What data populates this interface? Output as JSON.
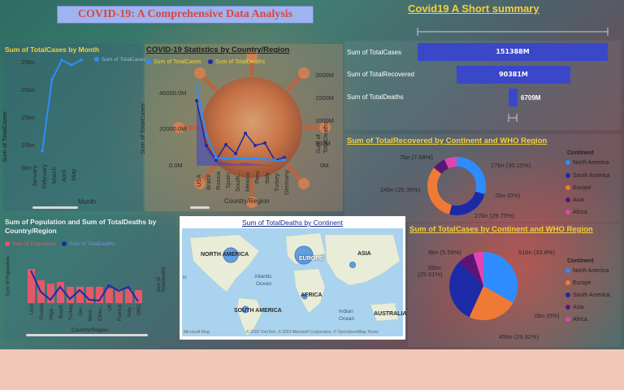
{
  "header": {
    "title": "COVID-19: A Comprehensive Data Analysis",
    "summary_title": "Covid19 A Short summary"
  },
  "colors": {
    "blue": "#2f8cff",
    "navy": "#1c2aa8",
    "orange": "#ef7a36",
    "purple": "#5b1577",
    "pink": "#e045b3",
    "bar": "#3b47c9",
    "population_bar": "#e4596a"
  },
  "summary": {
    "rows": [
      {
        "label": "Sum of TotalCases",
        "value_text": "151388M",
        "value": 151388
      },
      {
        "label": "Sum of TotalRecovered",
        "value_text": "90381M",
        "value": 90381
      },
      {
        "label": "Sum of TotalDeaths",
        "value_text": "6709M",
        "value": 6709
      }
    ]
  },
  "month_chart": {
    "title": "Sum of TotalCases by Month",
    "legend": "Sum of TotalCases",
    "ylabel": "Sum of TotalCases",
    "xlabel": "Month",
    "yticks": [
      "25bn",
      "20bn",
      "15bn",
      "10bn",
      "5bn"
    ],
    "categories": [
      "January",
      "February",
      "March",
      "April",
      "May"
    ]
  },
  "country_chart": {
    "title": "COVID-19 Statistics by Country/Region",
    "legend_cases": "Sum of TotalCases",
    "legend_deaths": "Sum of TotalDeaths",
    "ylabel_left": "Sum of TotalCases",
    "ylabel_right": "Sum of TotalDeaths",
    "xlabel": "Country/Region",
    "yticks_left": [
      "40000.0M",
      "20000.0M",
      "0.0M"
    ],
    "yticks_right": [
      "2000M",
      "1500M",
      "1000M",
      "500M",
      "0M"
    ],
    "categories": [
      "USA",
      "Brazil",
      "Russia",
      "Spain",
      "South...",
      "Mexico",
      "Peru",
      "Italy",
      "Turkey",
      "Germany"
    ]
  },
  "population_chart": {
    "title": "Sum of Population and Sum of TotalDeaths by Country/Region",
    "legend_pop": "Sum of Population",
    "legend_deaths": "Sum of TotalDeaths",
    "ylabel_left": "Sum of Population",
    "ylabel_right": "Sum of TotalDeaths",
    "xlabel": "Country/Region",
    "categories": [
      "USA",
      "Russia",
      "Nige...",
      "Brazil",
      "Turkey",
      "Ger...",
      "Mexi...",
      "Ethio...",
      "UK",
      "France",
      "Italy",
      "DRC"
    ]
  },
  "map": {
    "title": "Sum of TotalDeaths by Continent",
    "labels": {
      "north_america": "NORTH AMERICA",
      "europe": "EUROPE",
      "asia": "ASIA",
      "africa": "AFRICA",
      "south_america": "SOUTH AMERICA",
      "australia": "AUSTRALIA",
      "atlantic": "Atlantic\nOcean",
      "atlantic_1": "Atlantic",
      "atlantic_2": "Ocean",
      "indian_1": "Indian",
      "indian_2": "Ocean",
      "pacific": "ic",
      "microsoft": "Microsoft Bing",
      "copyright": "© 2023 TomTom, © 2023 Microsoft Corporation, © OpenStreetMap  Terms"
    }
  },
  "recovered_chart": {
    "title": "Sum of TotalRecovered by Continent and WHO Region",
    "legend_title": "Continent",
    "legend": [
      "North America",
      "South America",
      "Europe",
      "Asia",
      "Africa"
    ],
    "labels": {
      "top_left": "7bn (7.68%)",
      "right": "27bn (30.15%)",
      "left": "24bn (26.39%)",
      "mid_right": "0bn (0%)",
      "bottom": "27bn (29.75%)"
    }
  },
  "cases_chart": {
    "title": "Sum of TotalCases by Continent and WHO Region",
    "legend_title": "Continent",
    "legend": [
      "North America",
      "Europe",
      "South America",
      "Asia",
      "Africa"
    ],
    "labels": {
      "top_left": "8bn (5.59%)",
      "left_1": "39bn",
      "left_2": "(25.91%)",
      "right": "51bn (33.8%)",
      "mid_right": "0bn (0%)",
      "bottom": "45bn (29.62%)"
    }
  }
}
